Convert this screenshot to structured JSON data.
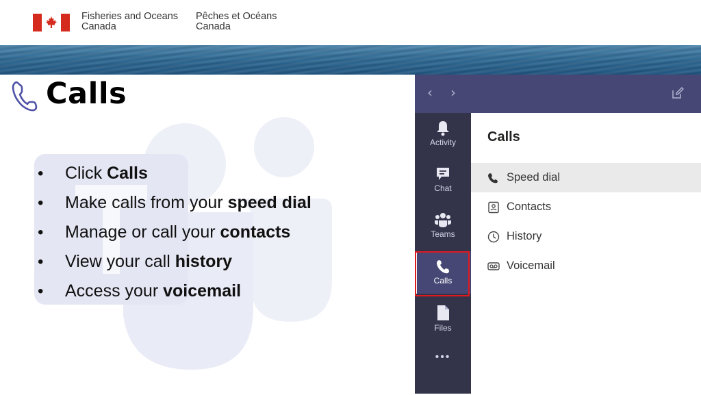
{
  "header": {
    "dept_en_line1": "Fisheries and Oceans",
    "dept_en_line2": "Canada",
    "dept_fr_line1": "Pêches et Océans",
    "dept_fr_line2": "Canada",
    "flag_icon": "canada-flag-icon"
  },
  "slide": {
    "title": "Calls",
    "title_icon": "phone-icon",
    "bullets": [
      {
        "text": "Click ",
        "bold": "Calls"
      },
      {
        "text": "Make calls from your ",
        "bold": "speed dial"
      },
      {
        "text": "Manage or call your ",
        "bold": "contacts"
      },
      {
        "text": "View your call ",
        "bold": "history"
      },
      {
        "text": "Access your ",
        "bold": "voicemail"
      }
    ]
  },
  "teams": {
    "top_bar": {
      "back_icon": "chevron-left-icon",
      "forward_icon": "chevron-right-icon",
      "compose_icon": "compose-icon"
    },
    "rail": [
      {
        "label": "Activity",
        "icon": "bell-icon"
      },
      {
        "label": "Chat",
        "icon": "chat-icon"
      },
      {
        "label": "Teams",
        "icon": "teams-icon"
      },
      {
        "label": "Calls",
        "icon": "phone-icon",
        "active": true
      },
      {
        "label": "Files",
        "icon": "file-icon"
      },
      {
        "label": "•••",
        "icon": "more-icon"
      }
    ],
    "panel": {
      "title": "Calls",
      "items": [
        {
          "label": "Speed dial",
          "icon": "phone-icon",
          "selected": true
        },
        {
          "label": "Contacts",
          "icon": "contact-card-icon"
        },
        {
          "label": "History",
          "icon": "clock-icon"
        },
        {
          "label": "Voicemail",
          "icon": "voicemail-icon"
        }
      ]
    },
    "colors": {
      "top_bar": "#464775",
      "rail": "#33344a",
      "highlight": "#e0191e"
    }
  }
}
